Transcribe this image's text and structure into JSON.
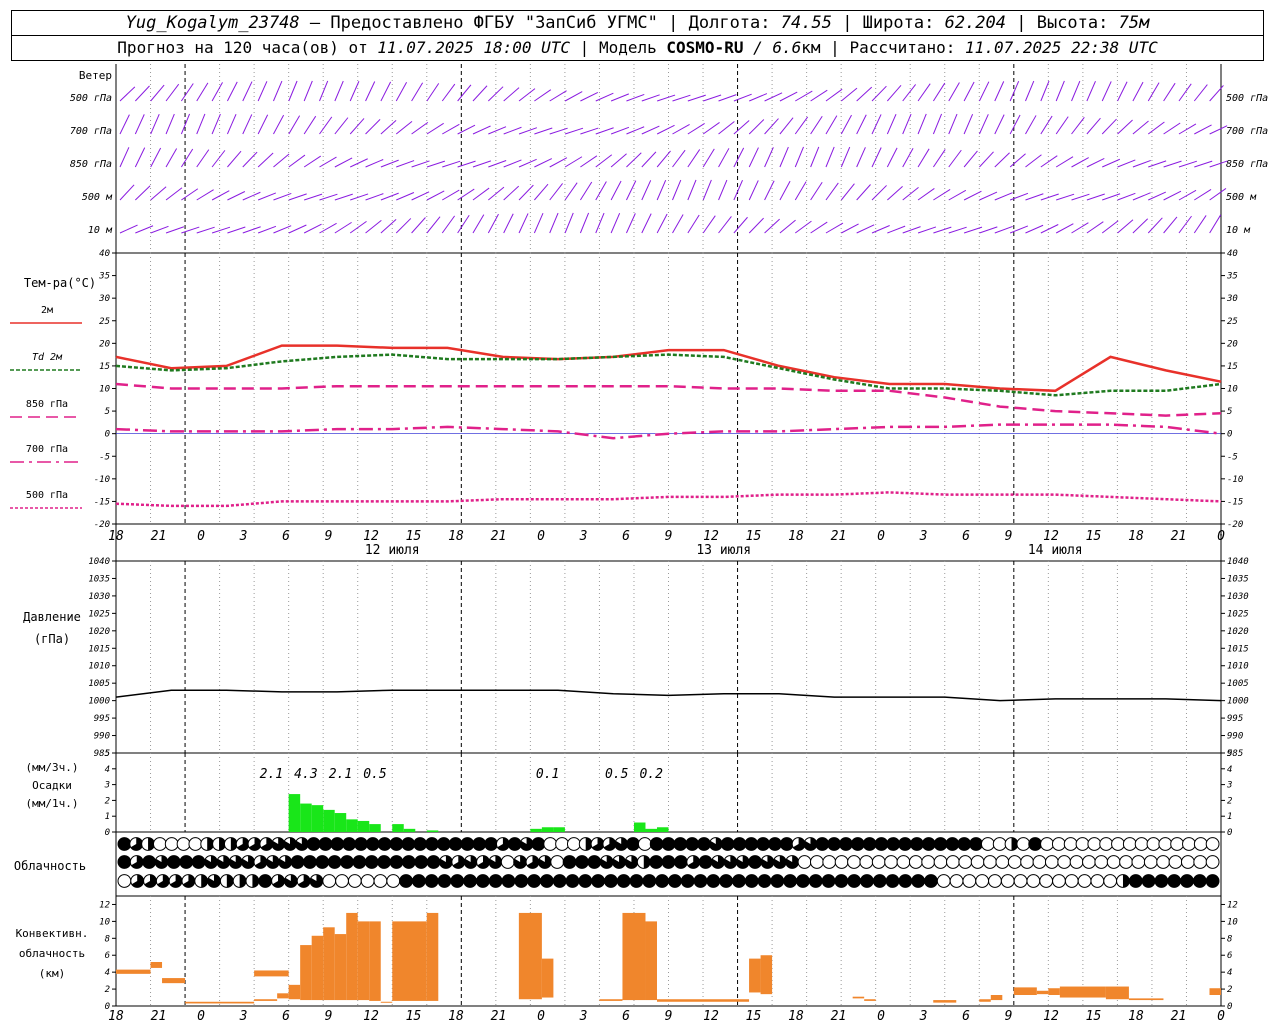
{
  "header": {
    "station": "Yug_Kogalym_23748",
    "provided_by": "— Предоставлено ФГБУ \"ЗапСиб УГМС\"",
    "lon_label": "Долгота:",
    "lon": "74.55",
    "lat_label": "Широта:",
    "lat": "62.204",
    "alt_label": "Высота:",
    "alt": "75м",
    "forecast_label": "Прогноз на 120 часа(ов) от",
    "forecast_from": "11.07.2025 18:00 UTC",
    "model_label": "Модель",
    "model": "COSMO-RU",
    "resolution": "/ 6.6",
    "resolution_unit": "км",
    "calc_label": "Рассчитано:",
    "calc_time": "11.07.2025 22:38 UTC"
  },
  "x_axis": {
    "hour_labels": [
      "18",
      "21",
      "0",
      "3",
      "6",
      "9",
      "12",
      "15",
      "18",
      "21",
      "0",
      "3",
      "6",
      "9",
      "12",
      "15",
      "18",
      "21",
      "0",
      "3",
      "6",
      "9",
      "12",
      "15",
      "18",
      "21",
      "0"
    ],
    "day_labels": [
      "12 июля",
      "13 июля",
      "14 июля"
    ]
  },
  "chart_data": [
    {
      "type": "wind_barbs",
      "title": "Ветер",
      "levels": [
        "500 гПа",
        "700 гПа",
        "850 гПа",
        "500 м",
        "10 м"
      ],
      "color": "#8a1be0"
    },
    {
      "type": "line",
      "title": "Тем-ра(°C)",
      "ylim": [
        -20,
        40
      ],
      "yticks": [
        -20,
        -15,
        -10,
        -5,
        0,
        5,
        10,
        15,
        20,
        25,
        30,
        35,
        40
      ],
      "x_hours": [
        0,
        6,
        12,
        18,
        24,
        30,
        36,
        42,
        48,
        54,
        60,
        66,
        72,
        78,
        84,
        90,
        96,
        102,
        108,
        114,
        120
      ],
      "series": [
        {
          "name": "2м",
          "color": "#e8312a",
          "style": "solid",
          "values": [
            17,
            14.5,
            15,
            19.5,
            19.5,
            19,
            19,
            17,
            16.5,
            17,
            18.5,
            18.5,
            15,
            12.5,
            11,
            11,
            10,
            9.5,
            17,
            14,
            11.5
          ]
        },
        {
          "name": "Td 2м",
          "color": "#1f7a1f",
          "style": "dotted",
          "values": [
            15,
            14,
            14.5,
            16,
            17,
            17.5,
            16.5,
            16.5,
            16.5,
            17,
            17.5,
            17,
            14.5,
            12,
            10,
            10,
            9.5,
            8.5,
            9.5,
            9.5,
            11
          ]
        },
        {
          "name": "850 гПа",
          "color": "#e0218a",
          "style": "dashed",
          "values": [
            11,
            10,
            10,
            10,
            10.5,
            10.5,
            10.5,
            10.5,
            10.5,
            10.5,
            10.5,
            10,
            10,
            9.5,
            9.5,
            8,
            6,
            5,
            4.5,
            4,
            4.5
          ]
        },
        {
          "name": "700 гПа",
          "color": "#e0218a",
          "style": "dashdot",
          "values": [
            1,
            0.5,
            0.5,
            0.5,
            1,
            1,
            1.5,
            1,
            0.5,
            -1,
            0,
            0.5,
            0.5,
            1,
            1.5,
            1.5,
            2,
            2,
            2,
            1.5,
            0
          ]
        },
        {
          "name": "500 гПа",
          "color": "#e0218a",
          "style": "dotted_fine",
          "values": [
            -15.5,
            -16,
            -16,
            -15,
            -15,
            -15,
            -15,
            -14.5,
            -14.5,
            -14.5,
            -14,
            -14,
            -13.5,
            -13.5,
            -13,
            -13.5,
            -13.5,
            -13.5,
            -14,
            -14.5,
            -15
          ]
        }
      ]
    },
    {
      "type": "line",
      "title": "Давление",
      "unit": "(гПа)",
      "ylim": [
        985,
        1040
      ],
      "yticks": [
        985,
        990,
        995,
        1000,
        1005,
        1010,
        1015,
        1020,
        1025,
        1030,
        1035,
        1040
      ],
      "x_hours": [
        0,
        6,
        12,
        18,
        24,
        30,
        36,
        42,
        48,
        54,
        60,
        66,
        72,
        78,
        84,
        90,
        96,
        102,
        108,
        114,
        120
      ],
      "series": [
        {
          "name": "",
          "color": "#000000",
          "style": "solid",
          "values": [
            1001,
            1003,
            1003,
            1002.5,
            1002.5,
            1003,
            1003,
            1003,
            1003,
            1002,
            1001.5,
            1002,
            1002,
            1001,
            1001,
            1001,
            1000,
            1000.5,
            1000.5,
            1000.5,
            1000
          ]
        }
      ]
    },
    {
      "type": "bar",
      "title": "Осадки",
      "units": [
        "(мм/3ч.)",
        "(мм/1ч.)"
      ],
      "ylim": [
        0,
        5
      ],
      "yticks": [
        0,
        1,
        2,
        3,
        4,
        5
      ],
      "color": "#19e619",
      "hourly": [
        [
          15,
          2.4
        ],
        [
          16,
          1.8
        ],
        [
          17,
          1.7
        ],
        [
          18,
          1.4
        ],
        [
          19,
          1.2
        ],
        [
          20,
          0.8
        ],
        [
          21,
          0.7
        ],
        [
          22,
          0.5
        ],
        [
          24,
          0.5
        ],
        [
          25,
          0.2
        ],
        [
          27,
          0.1
        ],
        [
          36,
          0.2
        ],
        [
          37,
          0.3
        ],
        [
          38,
          0.3
        ],
        [
          45,
          0.6
        ],
        [
          46,
          0.2
        ],
        [
          47,
          0.3
        ]
      ],
      "totals_3h": [
        {
          "x": 13.5,
          "text": "2.1"
        },
        {
          "x": 16.5,
          "text": "4.3"
        },
        {
          "x": 19.5,
          "text": "2.1"
        },
        {
          "x": 22.5,
          "text": "0.5"
        },
        {
          "x": 37.5,
          "text": "0.1"
        },
        {
          "x": 43.5,
          "text": "0.5"
        },
        {
          "x": 46.5,
          "text": "0.2"
        }
      ]
    },
    {
      "type": "table",
      "title": "Облачность",
      "rows": [
        "643000033344455566666666666666664656000344560666665666666456666666666666600306000000000000000",
        "64656665555455666666666666545450545066655536664655565550000000000000000000000000000000000",
        "04444435333645450000006666666666666666666666666666666666666666660000000000000036666666"
      ]
    },
    {
      "type": "bar",
      "title": "Конвективн. облачность",
      "unit": "(км)",
      "ylim": [
        0,
        13
      ],
      "yticks": [
        0,
        2,
        4,
        6,
        8,
        10,
        12
      ],
      "color": "#f0862c",
      "bars": [
        {
          "x0": 0,
          "x1": 3,
          "bottom": 3.8,
          "top": 4.3
        },
        {
          "x0": 12,
          "x1": 15,
          "bottom": 3.5,
          "top": 4.2
        },
        {
          "x0": 3,
          "x1": 4,
          "bottom": 4.5,
          "top": 5.2
        },
        {
          "x0": 4,
          "x1": 6,
          "bottom": 2.7,
          "top": 3.3
        },
        {
          "x0": 6,
          "x1": 12,
          "bottom": 0.3,
          "top": 0.5
        },
        {
          "x0": 12,
          "x1": 14,
          "bottom": 0.6,
          "top": 0.8
        },
        {
          "x0": 14,
          "x1": 15,
          "bottom": 0.9,
          "top": 1.5
        },
        {
          "x0": 15,
          "x1": 16,
          "bottom": 0.8,
          "top": 2.5
        },
        {
          "x0": 16,
          "x1": 17,
          "bottom": 0.7,
          "top": 7.2
        },
        {
          "x0": 17,
          "x1": 18,
          "bottom": 0.7,
          "top": 8.3
        },
        {
          "x0": 18,
          "x1": 19,
          "bottom": 0.7,
          "top": 9.3
        },
        {
          "x0": 19,
          "x1": 20,
          "bottom": 0.7,
          "top": 8.5
        },
        {
          "x0": 20,
          "x1": 21,
          "bottom": 0.7,
          "top": 11
        },
        {
          "x0": 21,
          "x1": 22,
          "bottom": 0.7,
          "top": 10
        },
        {
          "x0": 22,
          "x1": 23,
          "bottom": 0.6,
          "top": 10
        },
        {
          "x0": 23,
          "x1": 24,
          "bottom": 0.5,
          "top": 0.5
        },
        {
          "x0": 24,
          "x1": 27,
          "bottom": 0.6,
          "top": 10
        },
        {
          "x0": 27,
          "x1": 28,
          "bottom": 0.6,
          "top": 11
        },
        {
          "x0": 35,
          "x1": 37,
          "bottom": 0.8,
          "top": 11
        },
        {
          "x0": 37,
          "x1": 38,
          "bottom": 1.0,
          "top": 5.6
        },
        {
          "x0": 42,
          "x1": 44,
          "bottom": 0.6,
          "top": 0.8
        },
        {
          "x0": 44,
          "x1": 46,
          "bottom": 0.7,
          "top": 11
        },
        {
          "x0": 46,
          "x1": 47,
          "bottom": 0.7,
          "top": 10
        },
        {
          "x0": 47,
          "x1": 55,
          "bottom": 0.5,
          "top": 0.8
        },
        {
          "x0": 55,
          "x1": 56,
          "bottom": 1.6,
          "top": 5.6
        },
        {
          "x0": 56,
          "x1": 57,
          "bottom": 1.4,
          "top": 6
        },
        {
          "x0": 64,
          "x1": 65,
          "bottom": 0.9,
          "top": 1.1
        },
        {
          "x0": 65,
          "x1": 66,
          "bottom": 0.6,
          "top": 0.8
        },
        {
          "x0": 71,
          "x1": 73,
          "bottom": 0.4,
          "top": 0.7
        },
        {
          "x0": 75,
          "x1": 76,
          "bottom": 0.5,
          "top": 0.8
        },
        {
          "x0": 76,
          "x1": 77,
          "bottom": 0.7,
          "top": 1.3
        },
        {
          "x0": 78,
          "x1": 80,
          "bottom": 1.3,
          "top": 2.2
        },
        {
          "x0": 80,
          "x1": 81,
          "bottom": 1.4,
          "top": 1.8
        },
        {
          "x0": 81,
          "x1": 82,
          "bottom": 1.3,
          "top": 2.1
        },
        {
          "x0": 82,
          "x1": 86,
          "bottom": 1.0,
          "top": 2.3
        },
        {
          "x0": 86,
          "x1": 88,
          "bottom": 0.8,
          "top": 2.3
        },
        {
          "x0": 88,
          "x1": 91,
          "bottom": 0.7,
          "top": 0.9
        },
        {
          "x0": 95,
          "x1": 96,
          "bottom": 1.3,
          "top": 2.1
        }
      ]
    }
  ]
}
